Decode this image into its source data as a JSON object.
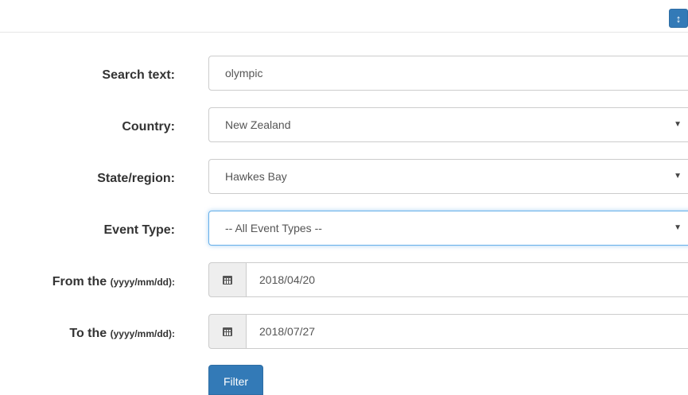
{
  "header": {
    "toggle_icon": "vertical-resize-arrows-icon",
    "toggle_glyph": "↕",
    "accent_color": "#337ab7"
  },
  "form": {
    "search_text": {
      "label": "Search text:",
      "value": "olympic"
    },
    "country": {
      "label": "Country:",
      "selected": "New Zealand"
    },
    "state_region": {
      "label": "State/region:",
      "selected": "Hawkes Bay"
    },
    "event_type": {
      "label": "Event Type:",
      "selected": "-- All Event Types --"
    },
    "from_date": {
      "label": "From the",
      "hint": "(yyyy/mm/dd):",
      "value": "2018/04/20",
      "icon": "calendar-icon"
    },
    "to_date": {
      "label": "To the",
      "hint": "(yyyy/mm/dd):",
      "value": "2018/07/27",
      "icon": "calendar-icon"
    },
    "select_arrow": "▼",
    "filter_label": "Filter"
  }
}
